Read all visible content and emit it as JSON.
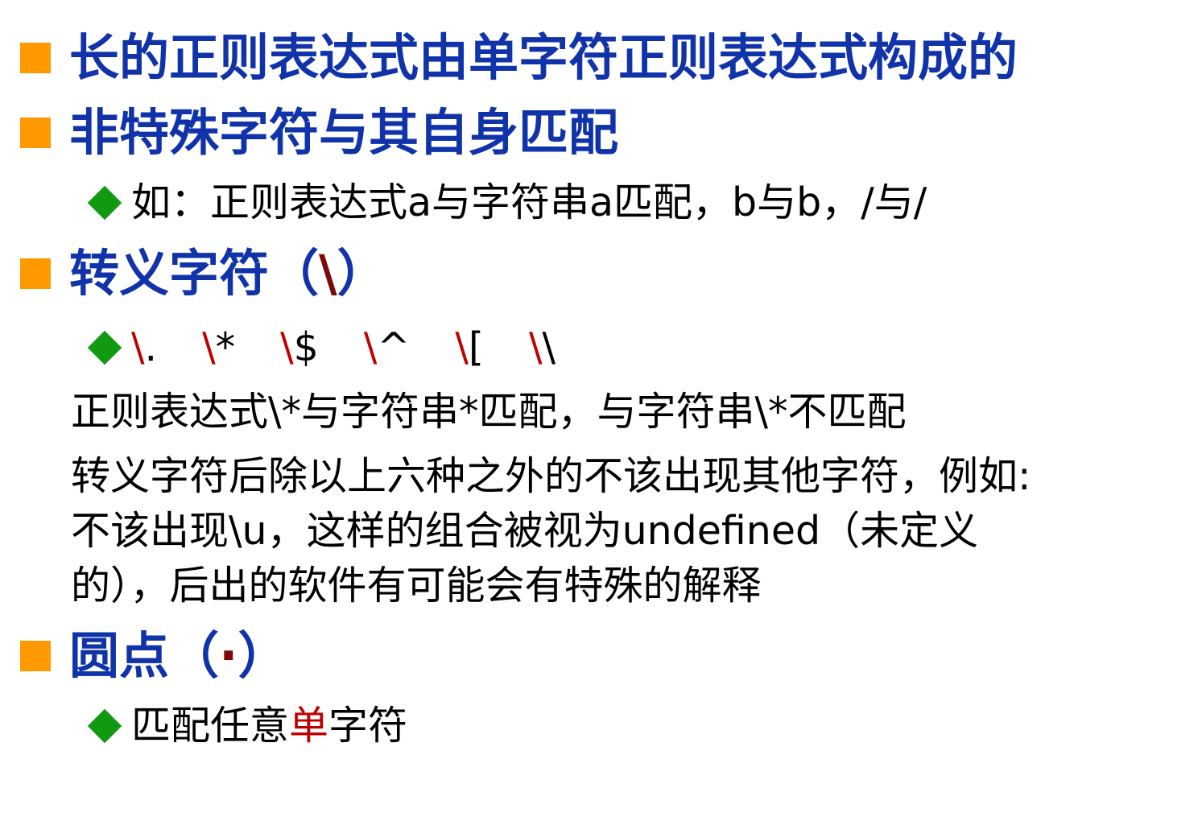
{
  "bullets": {
    "b1": "长的正则表达式由单字符正则表达式构成的",
    "b2": "非特殊字符与其自身匹配",
    "b2_sub": "如：正则表达式a与字符串a匹配，b与b，/与/",
    "b3_label": "转义字符（",
    "b3_slash": "\\",
    "b3_close": "）",
    "b3_sub": {
      "escapes": [
        "\\.",
        "\\*",
        "\\$",
        "\\^",
        "\\[",
        "\\\\"
      ]
    },
    "para1": "正则表达式\\*与字符串*匹配，与字符串\\*不匹配",
    "para2_line1": "转义字符后除以上六种之外的不该出现其他字符，例如:",
    "para2_line2": "不该出现\\u，这样的组合被视为undefined（未定义",
    "para2_line3": "的），后出的软件有可能会有特殊的解释",
    "b4_label": "圆点（",
    "b4_dot": "·",
    "b4_close": "）",
    "b4_sub_pre": "匹配任意",
    "b4_sub_red": "单",
    "b4_sub_post": "字符"
  },
  "colors": {
    "bullet_square": "#ff9900",
    "bullet_diamond": "#119911",
    "heading_text": "#1133aa",
    "escape_red": "#c00000",
    "dark_red": "#7a0a0a"
  }
}
